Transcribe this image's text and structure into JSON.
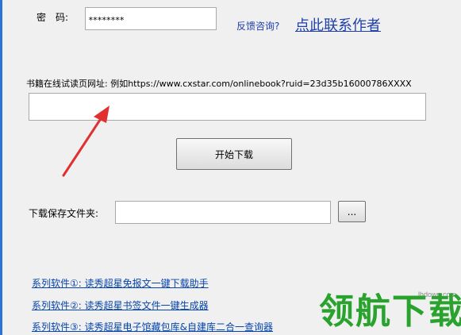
{
  "login": {
    "password_label": "密　码:",
    "password_value": "********"
  },
  "feedback": {
    "prompt": "反馈咨询?",
    "contact_link": "点此联系作者"
  },
  "url_section": {
    "label": "书籍在线试读页网址: 例如https://www.cxstar.com/onlinebook?ruid=23d35b16000786XXXX",
    "value": ""
  },
  "download": {
    "start_button": "开始下载"
  },
  "folder": {
    "label": "下载保存文件夹:",
    "value": "",
    "browse_button": "..."
  },
  "series": [
    {
      "label": "系列软件①: 读秀超星免报文一键下载助手"
    },
    {
      "label": "系列软件②: 读秀超星书签文件一键生成器"
    },
    {
      "label": "系列软件③: 读秀超星电子馆藏包库&自建库二合一查询器"
    }
  ],
  "watermark": {
    "text": "领航下载",
    "site": "lhdown.com"
  },
  "colors": {
    "link": "#0645ad",
    "arrow": "#e03030",
    "watermark": "#2aa22e"
  }
}
